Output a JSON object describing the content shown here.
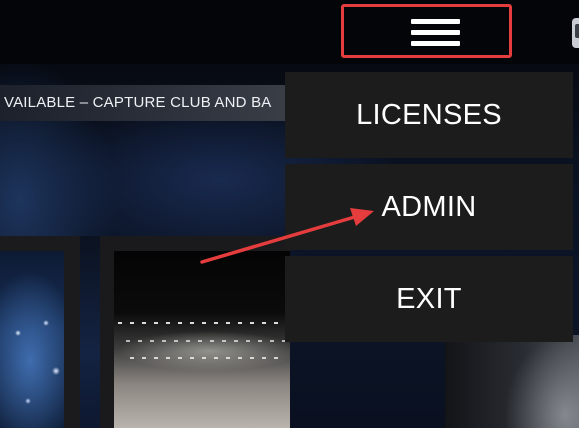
{
  "header": {
    "menu_toggle_icon": "hamburger-menu-icon",
    "annotation_color": "#e53d3d"
  },
  "ticker": {
    "text": "VAILABLE – CAPTURE CLUB AND BA"
  },
  "menu": {
    "items": [
      {
        "label": "LICENSES"
      },
      {
        "label": "ADMIN"
      },
      {
        "label": "EXIT"
      }
    ]
  },
  "annotation": {
    "arrow_color": "#e53d3d",
    "points_to": "ADMIN"
  }
}
